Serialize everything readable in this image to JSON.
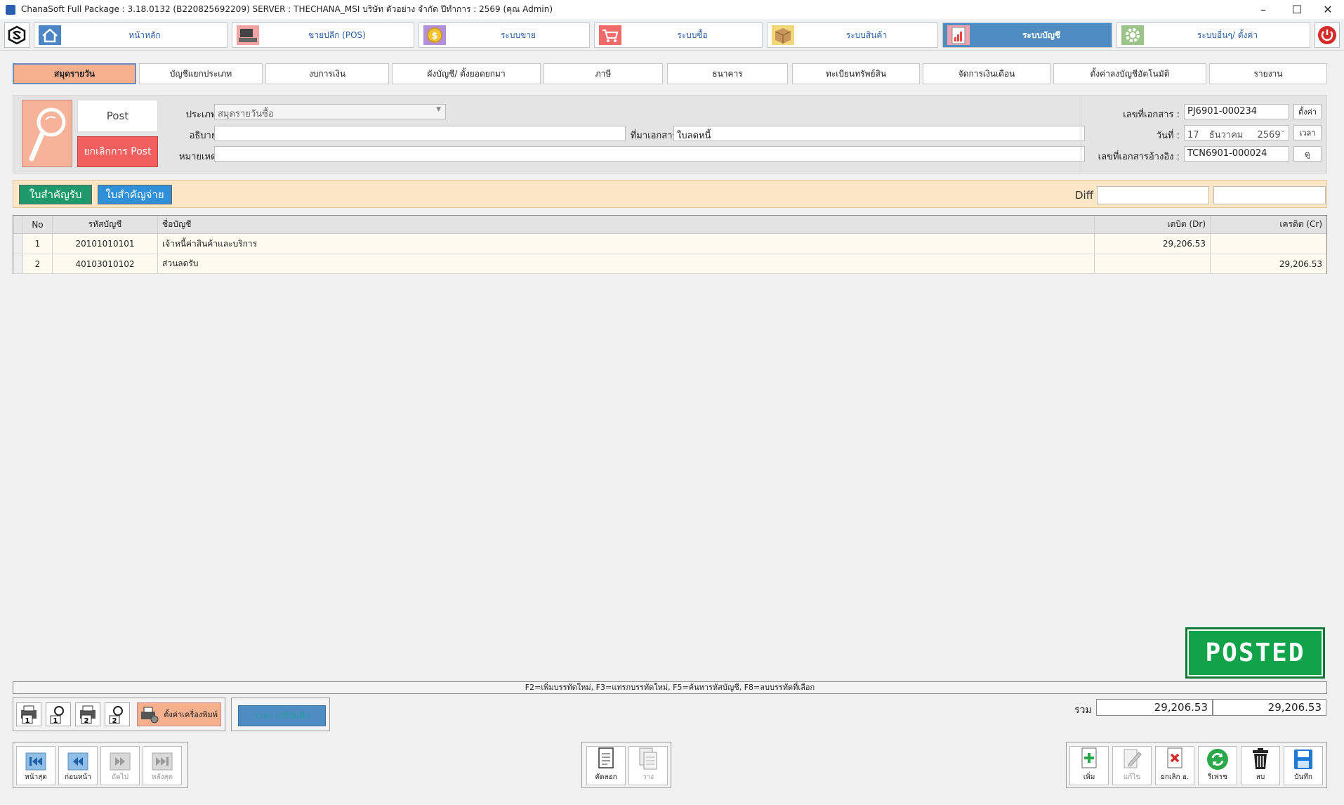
{
  "window": {
    "title": "ChanaSoft Full Package : 3.18.0132 (B220825692209) SERVER : THECHANA_MSI บริษัท ตัวอย่าง จำกัด ปีทำการ : 2569 (คุณ Admin)",
    "minimize": "–",
    "maximize": "☐",
    "close": "✕"
  },
  "modules": [
    {
      "label": "หน้าหลัก",
      "icon": "home-icon"
    },
    {
      "label": "ขายปลีก (POS)",
      "icon": "pos-icon"
    },
    {
      "label": "ระบบขาย",
      "icon": "dollar-coin-icon"
    },
    {
      "label": "ระบบซื้อ",
      "icon": "shopping-cart-icon"
    },
    {
      "label": "ระบบสินค้า",
      "icon": "box-icon"
    },
    {
      "label": "ระบบบัญชี",
      "icon": "ledger-chart-icon",
      "active": true
    },
    {
      "label": "ระบบอื่นๆ/ ตั้งค่า",
      "icon": "gear-icon"
    }
  ],
  "subtabs": [
    {
      "label": "สมุดรายวัน",
      "active": true
    },
    {
      "label": "บัญชีแยกประเภท"
    },
    {
      "label": "งบการเงิน"
    },
    {
      "label": "ผังบัญชี/ ตั้งยอดยกมา"
    },
    {
      "label": "ภาษี"
    },
    {
      "label": "ธนาคาร"
    },
    {
      "label": "ทะเบียนทรัพย์สิน"
    },
    {
      "label": "จัดการเงินเดือน"
    },
    {
      "label": "ตั้งค่าลงบัญชีอัตโนมัติ"
    },
    {
      "label": "รายงาน"
    }
  ],
  "header": {
    "post_label": "Post",
    "unpost_label": "ยกเลิกการ Post",
    "type_label": "ประเภท :",
    "type_value": "สมุดรายวันซื้อ",
    "desc_label": "อธิบาย :",
    "desc_value": "",
    "source_label": "ที่มาเอกสาร :",
    "source_value": "ใบลดหนี้",
    "note_label": "หมายเหตุ :",
    "note_value": "",
    "docno_label": "เลขที่เอกสาร :",
    "docno_value": "PJ6901-000234",
    "docno_btn": "ตั้งค่า",
    "date_label": "วันที่ :",
    "date_day": "17",
    "date_month": "ธันวาคม",
    "date_year": "2569",
    "time_btn": "เวลา",
    "refno_label": "เลขที่เอกสารอ้างอิง :",
    "refno_value": "TCN6901-000024",
    "refno_btn": "ดู"
  },
  "receipt_bar": {
    "receive_label": "ใบสำคัญรับ",
    "pay_label": "ใบสำคัญจ่าย",
    "diff_label": "Diff",
    "diff_dr": "",
    "diff_cr": ""
  },
  "grid": {
    "columns": [
      "No",
      "รหัสบัญชี",
      "ชื่อบัญชี",
      "เดบิต (Dr)",
      "เครดิต (Cr)"
    ],
    "rows": [
      {
        "no": "1",
        "code": "20101010101",
        "name": "เจ้าหนี้ค่าสินค้าและบริการ",
        "dr": "29,206.53",
        "cr": ""
      },
      {
        "no": "2",
        "code": "40103010102",
        "name": "ส่วนลดรับ",
        "dr": "",
        "cr": "29,206.53"
      }
    ]
  },
  "posted_stamp": "POSTED",
  "shortcuts": "F2=เพิ่มบรรทัดใหม่,   F3=แทรกบรรทัดใหม่,   F5=ค้นหารหัสบัญชี,   F8=ลบบรรทัดที่เลือก",
  "print": {
    "printer_setup_label": "ตั้งค่าเครื่องพิมพ์",
    "list_button_label": "รายการที่บันทึก"
  },
  "totals": {
    "label": "รวม",
    "dr": "29,206.53",
    "cr": "29,206.53"
  },
  "nav": [
    {
      "label": "หน้าสุด",
      "icon": "first-record-icon"
    },
    {
      "label": "ก่อนหน้า",
      "icon": "previous-record-icon"
    },
    {
      "label": "ถัดไป",
      "icon": "next-record-icon"
    },
    {
      "label": "หลังสุด",
      "icon": "last-record-icon"
    }
  ],
  "clipboard": [
    {
      "label": "คัดลอก",
      "icon": "copy-icon"
    },
    {
      "label": "วาง",
      "icon": "paste-icon"
    }
  ],
  "actions": [
    {
      "label": "เพิ่ม",
      "icon": "add-icon"
    },
    {
      "label": "แก้ไข",
      "icon": "edit-icon"
    },
    {
      "label": "ยกเลิก อ.",
      "icon": "cancel-doc-icon"
    },
    {
      "label": "รีเฟรช",
      "icon": "refresh-icon"
    },
    {
      "label": "ลบ",
      "icon": "trash-icon"
    },
    {
      "label": "บันทึก",
      "icon": "save-icon"
    }
  ],
  "colors": {
    "accent_blue": "#4f8cc2",
    "active_tab": "#f6b08e",
    "unpost_red": "#f25f5f",
    "posted_green": "#12a34a",
    "receive_green": "#1e9a6a",
    "pay_blue": "#2f8fd8"
  }
}
